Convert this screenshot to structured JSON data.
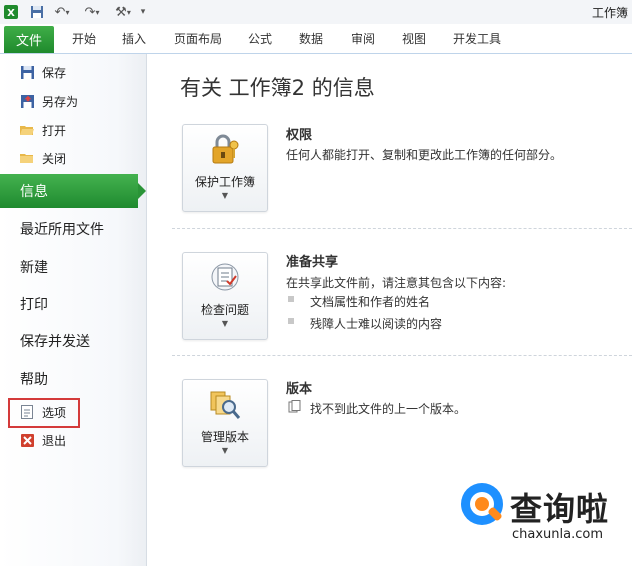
{
  "window": {
    "title": "工作簿"
  },
  "qat": {
    "icons": [
      "excel-logo-icon",
      "save-icon",
      "undo-icon",
      "redo-icon",
      "customize-icon"
    ]
  },
  "ribbon": {
    "file_tab": "文件",
    "tabs": [
      "开始",
      "插入",
      "页面布局",
      "公式",
      "数据",
      "审阅",
      "视图",
      "开发工具"
    ]
  },
  "sidebar": {
    "small_items": [
      {
        "label": "保存",
        "icon": "save-icon"
      },
      {
        "label": "另存为",
        "icon": "save-as-icon"
      },
      {
        "label": "打开",
        "icon": "open-folder-icon"
      },
      {
        "label": "关闭",
        "icon": "close-folder-icon"
      }
    ],
    "active_item": "信息",
    "big_items": [
      "最近所用文件",
      "新建",
      "打印",
      "保存并发送",
      "帮助"
    ],
    "bottom_items": [
      {
        "label": "选项",
        "icon": "options-icon"
      },
      {
        "label": "退出",
        "icon": "exit-icon"
      }
    ],
    "highlight_color": "#d43a3a"
  },
  "main": {
    "title": "有关 工作簿2 的信息",
    "sections": [
      {
        "button_label": "保护工作簿",
        "button_icon": "lock-key-icon",
        "title": "权限",
        "description": "任何人都能打开、复制和更改此工作簿的任何部分。"
      },
      {
        "button_label": "检查问题",
        "button_icon": "inspect-checklist-icon",
        "title": "准备共享",
        "description": "在共享此文件前，请注意其包含以下内容:",
        "bullets": [
          "文档属性和作者的姓名",
          "残障人士难以阅读的内容"
        ]
      },
      {
        "button_label": "管理版本",
        "button_icon": "versions-magnifier-icon",
        "title": "版本",
        "description": "找不到此文件的上一个版本。"
      }
    ]
  },
  "watermark": {
    "brand": "查询啦",
    "url": "chaxunla.com"
  },
  "colors": {
    "accent_green": "#1f8a2d",
    "ribbon_border": "#bfd4ea"
  }
}
